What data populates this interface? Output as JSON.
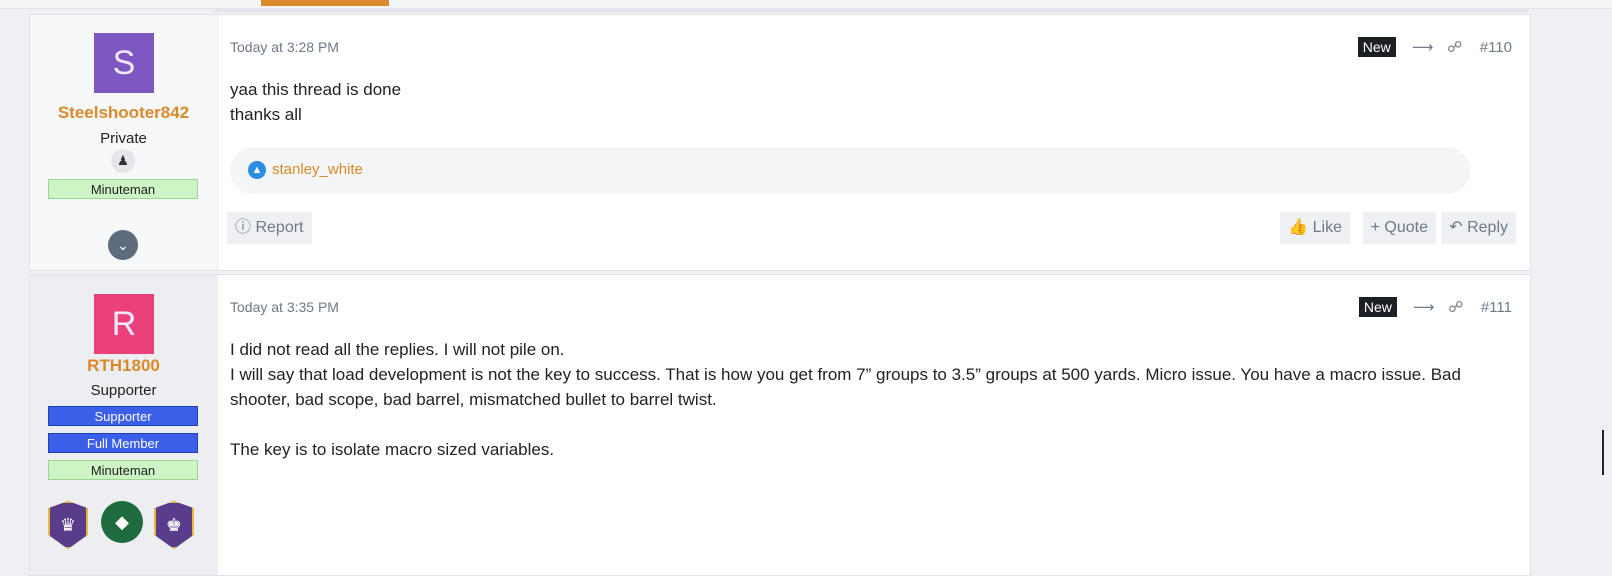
{
  "posts": [
    {
      "user": {
        "avatar_letter": "S",
        "avatar_color": "#7e57c2",
        "name": "Steelshooter842",
        "title": "Private",
        "role_icon": "user-tie-icon",
        "banners": [
          "Minuteman"
        ]
      },
      "date": "Today at 3:28 PM",
      "badge": "New",
      "number": "#110",
      "body": [
        "yaa this thread is done",
        "thanks all"
      ],
      "reaction_users": "stanley_white",
      "actions": {
        "report": "Report",
        "like": "Like",
        "quote": "Quote",
        "reply": "Reply"
      }
    },
    {
      "user": {
        "avatar_letter": "R",
        "avatar_color": "#ec407a",
        "name": "RTH1800",
        "title": "Supporter",
        "banners": [
          "Supporter",
          "Full Member",
          "Minuteman"
        ],
        "trophies": [
          "bulldog-trophy-icon",
          "diamond-trophy-icon",
          "cup-trophy-icon"
        ]
      },
      "date": "Today at 3:35 PM",
      "badge": "New",
      "number": "#111",
      "body": [
        "I did not read all the replies. I will not pile on.",
        "I will say that load development is not the key to success. That is how you get from 7” groups to 3.5” groups at 500 yards. Micro issue. You have a macro issue. Bad shooter, bad scope, bad barrel, mismatched bullet to barrel twist.",
        "",
        "The key is to isolate macro sized variables."
      ]
    }
  ],
  "colors": {
    "accent": "#d98a2b",
    "banner_green": "#ccf4c4",
    "banner_blue": "#3b5fe8",
    "new_badge": "#1c1f24"
  }
}
